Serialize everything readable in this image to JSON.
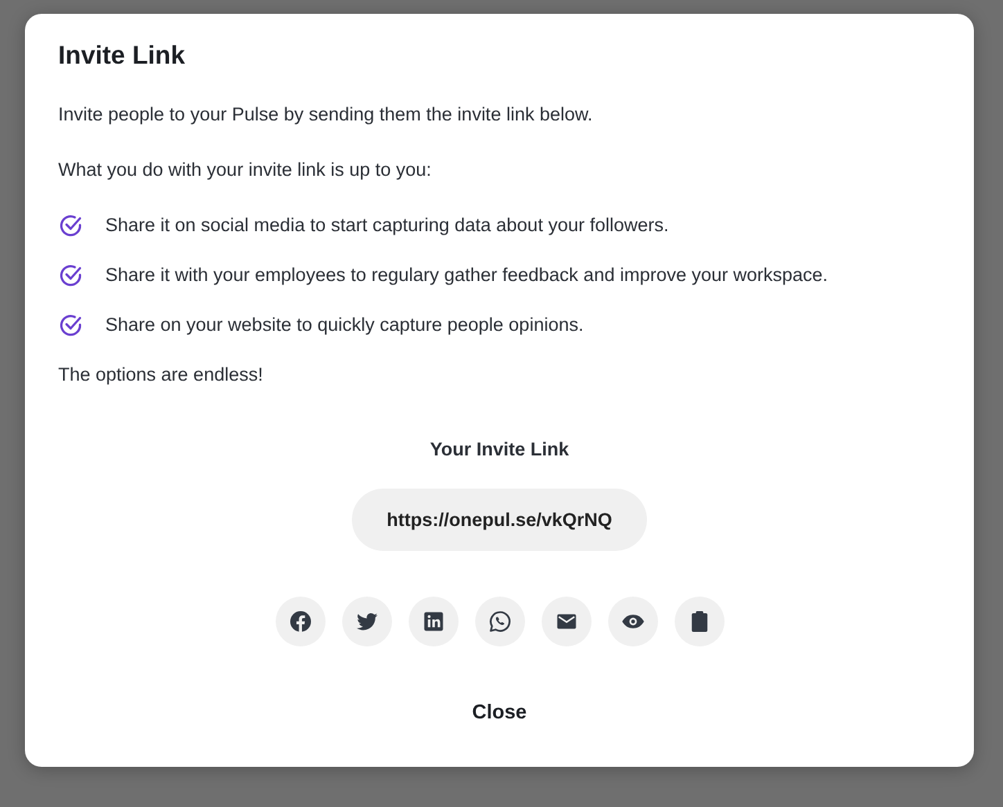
{
  "dialog": {
    "title": "Invite Link",
    "intro": "Invite people to your Pulse by sending them the invite link below.",
    "lead_in": "What you do with your invite link is up to you:",
    "checklist": [
      {
        "text": "Share it on social media to start capturing data about your followers."
      },
      {
        "text": "Share it with your employees to regulary gather feedback and improve your workspace."
      },
      {
        "text": "Share on your website to quickly capture people opinions."
      }
    ],
    "outro": "The options are endless!",
    "link_heading": "Your Invite Link",
    "link": "https://onepul.se/vkQrNQ",
    "share_buttons": [
      {
        "kind": "facebook"
      },
      {
        "kind": "twitter"
      },
      {
        "kind": "linkedin"
      },
      {
        "kind": "whatsapp"
      },
      {
        "kind": "email"
      },
      {
        "kind": "preview"
      },
      {
        "kind": "copy"
      }
    ],
    "close_button": "Close"
  }
}
